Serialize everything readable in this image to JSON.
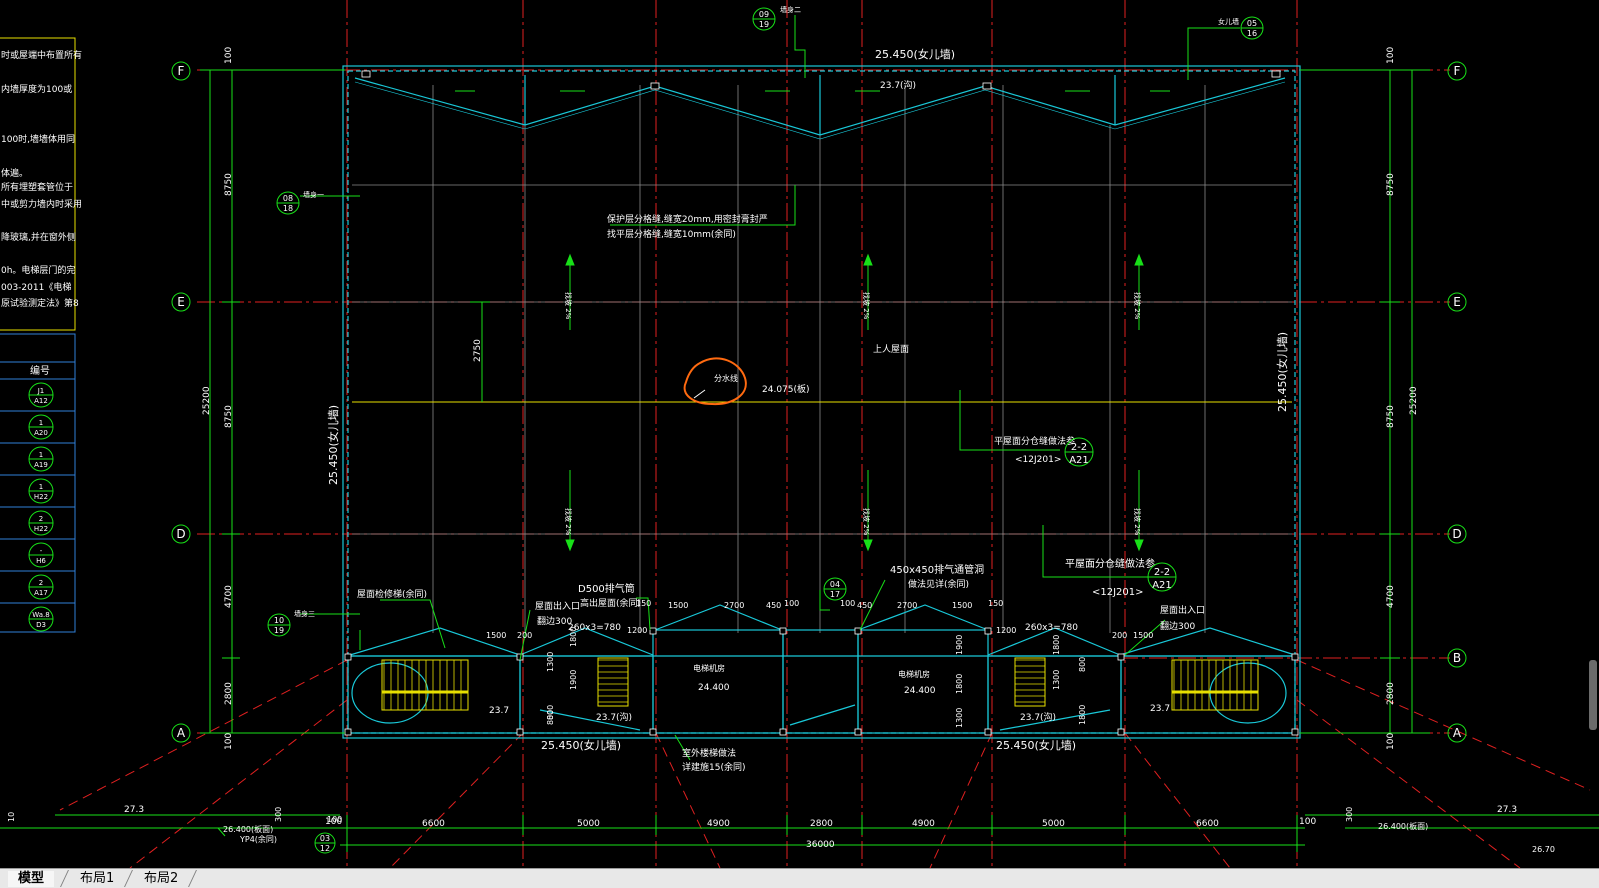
{
  "left_panel": {
    "notes": [
      "时或屋端中布置所有",
      "内墙厚度为100或",
      "100时,墙墙体用同",
      "体遍。",
      "所有埋塑套管位于",
      "中或剪力墙内时采用",
      "降玻璃,并在窗外侧",
      "0h。电梯层门的完",
      "003-2011《电梯",
      "原试验测定法》第8"
    ],
    "table_header": "编号",
    "table_symbols": [
      {
        "top": "J1",
        "bottom": "A12"
      },
      {
        "top": "1",
        "bottom": "A20"
      },
      {
        "top": "1",
        "bottom": "A19"
      },
      {
        "top": "1",
        "bottom": "H22"
      },
      {
        "top": "2",
        "bottom": "H22"
      },
      {
        "top": "-",
        "bottom": "H6"
      },
      {
        "top": "2",
        "bottom": "A17"
      },
      {
        "top": "Wa.8",
        "bottom": "D3"
      }
    ]
  },
  "axes": {
    "F": "F",
    "E": "E",
    "D": "D",
    "B": "B",
    "A": "A"
  },
  "dimensions": {
    "left_overall": "25200",
    "right_overall": "25200",
    "left_segments": [
      "100",
      "8750",
      "8750",
      "4700",
      "2800",
      "100"
    ],
    "right_segments": [
      "100",
      "8750",
      "8750",
      "4700",
      "2800",
      "100"
    ],
    "bottom_segments": [
      "100",
      "6600",
      "5000",
      "4900",
      "2800",
      "4900",
      "5000",
      "6600",
      "100"
    ],
    "bottom_overall": "36000",
    "inner_2750": "2750",
    "stair_dims": [
      "1500",
      "200",
      "1200",
      "1500",
      "2700",
      "450",
      "100",
      "100",
      "450",
      "2700",
      "1500",
      "150",
      "1200",
      "200",
      "1500",
      "150",
      "1800",
      "1900",
      "1300",
      "800",
      "1900",
      "1800",
      "1300",
      "1300",
      "1800",
      "800",
      "1800",
      "800"
    ]
  },
  "labels": {
    "parapet_top": "25.450(女儿墙)",
    "parapet_left": "25.450(女儿墙)",
    "parapet_right": "25.450(女儿墙)",
    "parapet_bottom_left": "25.450(女儿墙)",
    "parapet_bottom_right": "25.450(女儿墙)",
    "gutter_top": "23.7(沟)",
    "level_mid": "24.075(板)",
    "protect_note_1": "保护层分格缝,缝宽20mm,用密封膏封严",
    "protect_note_2": "找平层分格缝,缝宽10mm(余同)",
    "roof_access": "上人屋面",
    "split_water": "分水线",
    "joint_ref_1": "平屋面分仓缝做法参",
    "joint_ref_1_std": "<12J201>",
    "joint_ref_2": "平屋面分仓缝做法参",
    "joint_ref_2_std": "<12J201>",
    "joint_sym": {
      "top": "2-2",
      "bottom": "A21"
    },
    "exhaust_d500_1": "D500排气筒",
    "exhaust_d500_2": "高出屋面(余同)",
    "exhaust_450_1": "450x450排气通管洞",
    "exhaust_450_2": "做法见详(余同)",
    "roof_ladder": "屋面检修梯(余同)",
    "roof_exit_left": "屋面出入口",
    "roof_exit_left_2": "翻边300",
    "roof_exit_right": "屋面出入口",
    "roof_exit_right_2": "翻边300",
    "step_left": "260x3=780",
    "step_right": "260x3=780",
    "elev_room_1": "电梯机房",
    "elev_room_1_lvl": "24.400",
    "elev_room_2": "电梯机房",
    "elev_room_2_lvl": "24.400",
    "lvl_237_a": "23.7",
    "lvl_237_b": "23.7(沟)",
    "lvl_237_c": "23.7(沟)",
    "lvl_237_d": "23.7",
    "ext_ladder_1": "室外楼梯做法",
    "ext_ladder_2": "详建施15(余同)",
    "slope": "2%",
    "slope_label": "找坡",
    "wall_tag_1": "墙身一",
    "wall_tag_2": "墙身二",
    "wall_tag_3": "墙身三",
    "wall_tag_4": "女儿墙",
    "sym_09_19": {
      "top": "09",
      "bottom": "19"
    },
    "sym_05_16": {
      "top": "05",
      "bottom": "16"
    },
    "sym_08_18": {
      "top": "08",
      "bottom": "18"
    },
    "sym_10_19": {
      "top": "10",
      "bottom": "19"
    },
    "sym_04_17": {
      "top": "04",
      "bottom": "17"
    },
    "sym_03": {
      "top": "03",
      "bottom": "12"
    },
    "bl_273": "27.3",
    "bl_264": "26.400(板面)",
    "bl_yp": "YP4(余同)",
    "bl_300": "300",
    "bl_100": "100",
    "bl_10": "10",
    "br_273": "27.3",
    "br_264": "26.400(板面)",
    "br_300": "300",
    "br_2670": "26.70"
  },
  "tabs": [
    "模型",
    "布局1",
    "布局2"
  ],
  "colors": {
    "background": "#000000",
    "wall_cyan": "#19c8d8",
    "axis_red": "#e02020",
    "dim_green": "#18e018",
    "grid_gray": "#8a8a8a",
    "yellow": "#e8e000",
    "highlight_orange": "#ff6a10",
    "panel_blue": "#2f7fd8"
  }
}
